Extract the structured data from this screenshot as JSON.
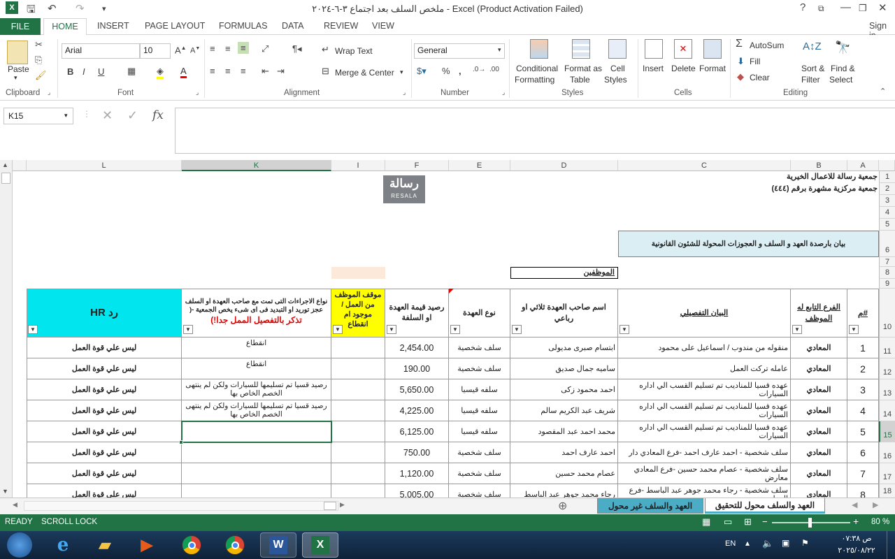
{
  "window": {
    "title": "ملخص السلف بعد اجتماع ٣-٦-٢٠٢٤ - Excel (Product Activation Failed)",
    "help": "?",
    "sign_in": "Sign in"
  },
  "tabs": [
    "FILE",
    "HOME",
    "INSERT",
    "PAGE LAYOUT",
    "FORMULAS",
    "DATA",
    "REVIEW",
    "VIEW"
  ],
  "ribbon": {
    "paste": "Paste",
    "clipboard": "Clipboard",
    "font_name": "Arial",
    "font_size": "10",
    "font": "Font",
    "wrap_text": "Wrap Text",
    "merge_center": "Merge & Center",
    "alignment": "Alignment",
    "number_format": "General",
    "number": "Number",
    "conditional": "Conditional",
    "formatting": "Formatting",
    "format_as": "Format as",
    "table": "Table",
    "cell": "Cell",
    "styles_btn": "Styles",
    "styles": "Styles",
    "insert": "Insert",
    "delete": "Delete",
    "format": "Format",
    "cells": "Cells",
    "autosum": "AutoSum",
    "fill": "Fill",
    "clear": "Clear",
    "sort": "Sort &",
    "filter": "Filter",
    "find": "Find &",
    "select": "Select",
    "editing": "Editing"
  },
  "namebox": "K15",
  "fx": "fx",
  "columns": [
    "L",
    "K",
    "I",
    "F",
    "E",
    "D",
    "C",
    "B",
    "A"
  ],
  "rows": [
    "1",
    "2",
    "3",
    "4",
    "5",
    "6",
    "7",
    "8",
    "9",
    "10",
    "11",
    "12",
    "13",
    "14",
    "15",
    "16",
    "17",
    "18"
  ],
  "sheet": {
    "org1": "جمعية رسالة للاعمال الخيرية",
    "org2": "جمعية مركزية مشهرة برقم (٤٤٤)",
    "logo": "رسالة",
    "logo_sub": "RESALA",
    "report_title": "بيان بارصدة العهد و السلف و العجوزات المحولة للشئون القانونية",
    "employees": "الموظفين",
    "headers": {
      "A": "#م",
      "B": "الفرع التابع له الموظف",
      "C": "البيان التفصيلي",
      "D": "اسم صاحب العهدة ثلاثي او رباعي",
      "E": "نوع العهدة",
      "F": "رصيد قيمة العهدة او السلفة",
      "I": "موقف الموظف من العمل /موجود ام انقطاع",
      "K1": "نواع الاجراءات التى تمت مع صاحب العهدة او السلف عجز توريد او التبديد فى اى شىء يخص الجمعية -(",
      "K2": "تذكر بالتفصيل الممل جدا!)",
      "L": "رد HR"
    },
    "data": [
      {
        "n": "1",
        "branch": "المعادي",
        "desc": "منقوله من مندوب / اسماعيل على محمود",
        "name": "ابتسام صبرى مديولى",
        "type": "سلف شخصية",
        "amount": "2,454.00",
        "status": "",
        "action": "انقطاع",
        "hr": "ليس علي قوة العمل"
      },
      {
        "n": "2",
        "branch": "المعادي",
        "desc": "عامله تركت العمل",
        "name": "ساميه جمال صديق",
        "type": "سلف شخصية",
        "amount": "190.00",
        "status": "",
        "action": "انقطاع",
        "hr": "ليس علي قوة العمل"
      },
      {
        "n": "3",
        "branch": "المعادي",
        "desc": "عهده قسيا للمناديب تم تسليم القسب الي اداره السيارات",
        "name": "احمد محمود زكى",
        "type": "سلفه قيسيا",
        "amount": "5,650.00",
        "status": "",
        "action": "رصيد قسيا تم تسليمها للسيارات ولكن لم ينتهى الخصم الخاص بها",
        "hr": "ليس علي قوة العمل"
      },
      {
        "n": "4",
        "branch": "المعادي",
        "desc": "عهده قسيا للمناديب تم تسليم القسب الي اداره السيارات",
        "name": "شريف عبد الكريم سالم",
        "type": "سلفه قيسيا",
        "amount": "4,225.00",
        "status": "",
        "action": "رصيد قسيا تم تسليمها للسيارات ولكن لم ينتهى الخصم الخاص بها",
        "hr": "ليس علي قوة العمل"
      },
      {
        "n": "5",
        "branch": "المعادي",
        "desc": "عهده قسيا للمناديب تم تسليم القسب الي اداره السيارات",
        "name": "محمد احمد عبد المقصود",
        "type": "سلفه قيسيا",
        "amount": "6,125.00",
        "status": "",
        "action": "",
        "hr": "ليس علي قوة العمل"
      },
      {
        "n": "6",
        "branch": "المعادي",
        "desc": "سلف شخصية - احمد عارف احمد -فرع المعادي دار",
        "name": "احمد عارف احمد",
        "type": "سلف شخصية",
        "amount": "750.00",
        "status": "",
        "action": "",
        "hr": "ليس علي قوة العمل"
      },
      {
        "n": "7",
        "branch": "المعادي",
        "desc": "سلف شخصية - عصام محمد حسين -فرع المعادي معارض",
        "name": "عصام محمد حسين",
        "type": "سلف شخصية",
        "amount": "1,120.00",
        "status": "",
        "action": "",
        "hr": "ليس علي قوة العمل"
      },
      {
        "n": "8",
        "branch": "المعادي",
        "desc": "سلف شخصية - رجاء محمد جوهر عبد الباسط -فرع المعادي",
        "name": "رجاء محمد جوهر عبد الباسط",
        "type": "سلف شخصية",
        "amount": "5,005.00",
        "status": "",
        "action": "",
        "hr": "ليس علي قوة العمل"
      }
    ]
  },
  "sheet_tabs": [
    "العهد والسلف محول للتحقيق",
    "العهد والسلف غير محول"
  ],
  "status": {
    "ready": "READY",
    "scroll_lock": "SCROLL LOCK",
    "zoom": "80 %"
  },
  "taskbar": {
    "lang": "EN",
    "time": "ص ٠٧:٣٨",
    "date": "٢٠٢٥/٠٨/٢٢"
  },
  "colors": {
    "excel_green": "#217346",
    "header_cyan": "#00e5ee",
    "header_yellow": "#ffff00",
    "title_box": "#daeef3",
    "peach": "#fde9d9"
  }
}
